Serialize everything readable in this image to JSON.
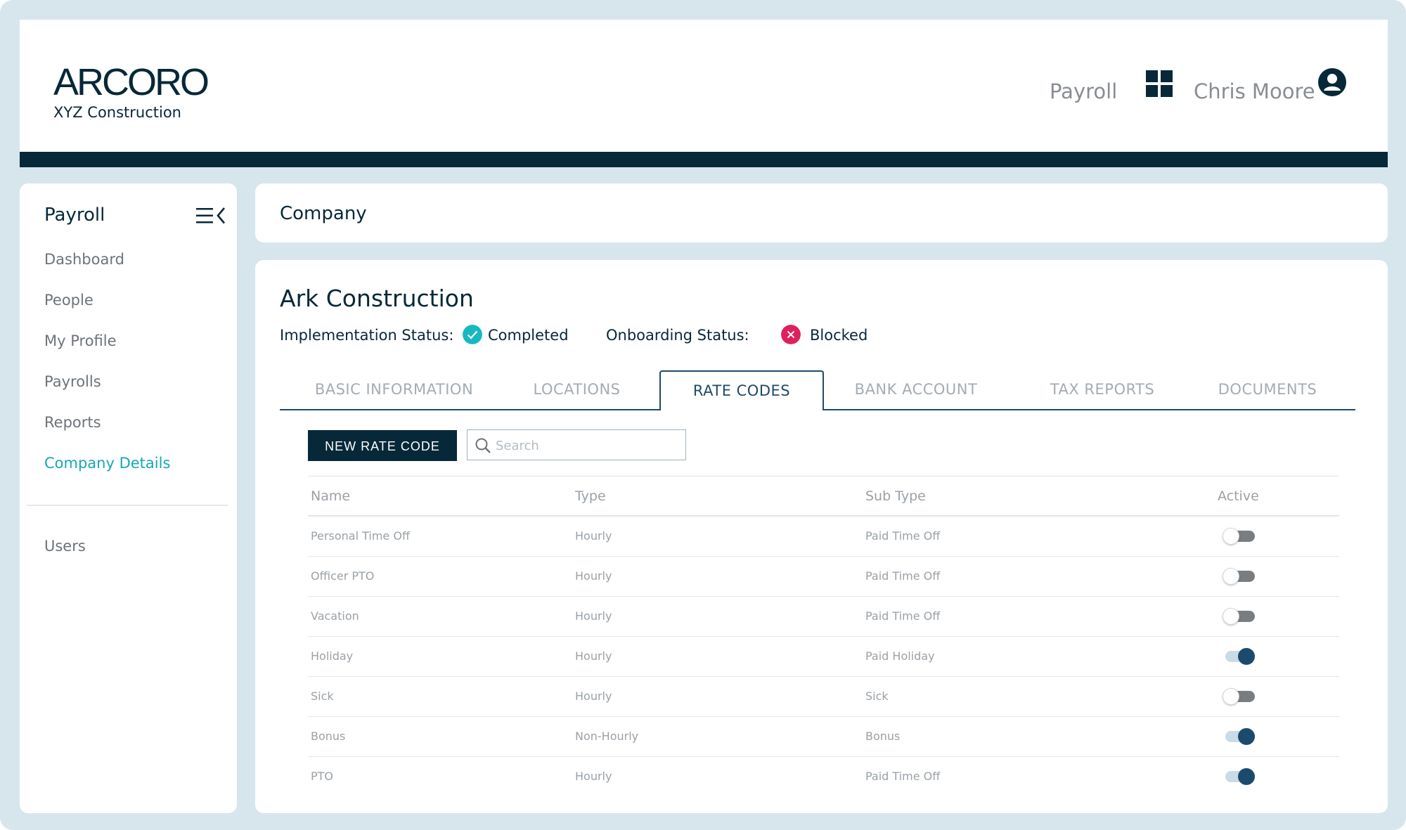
{
  "header": {
    "logo_text": "ARCORO",
    "company_subtitle": "XYZ Construction",
    "app_label": "Payroll",
    "app_switcher_icon": "grid-icon",
    "user_name": "Chris Moore",
    "user_icon": "user-circle-icon"
  },
  "sidebar": {
    "title": "Payroll",
    "toggle_icon": "menu-collapse-icon",
    "items": [
      {
        "label": "Dashboard",
        "active": false
      },
      {
        "label": "People",
        "active": false
      },
      {
        "label": "My Profile",
        "active": false
      },
      {
        "label": "Payrolls",
        "active": false
      },
      {
        "label": "Reports",
        "active": false
      },
      {
        "label": "Company Details",
        "active": true
      }
    ],
    "secondary_items": [
      {
        "label": "Users"
      }
    ]
  },
  "page": {
    "section_title": "Company",
    "company_name": "Ark Construction",
    "implementation_status_label": "Implementation Status:",
    "implementation_status_value": "Completed",
    "onboarding_status_label": "Onboarding Status:",
    "onboarding_status_value": "Blocked",
    "colors": {
      "completed": "#16b9c0",
      "blocked": "#e0205e",
      "accent": "#16a8b3",
      "primary_dark": "#062838"
    }
  },
  "tabs": [
    {
      "label": "BASIC INFORMATION",
      "active": false
    },
    {
      "label": "LOCATIONS",
      "active": false
    },
    {
      "label": "RATE CODES",
      "active": true
    },
    {
      "label": "BANK ACCOUNT",
      "active": false
    },
    {
      "label": "TAX REPORTS",
      "active": false
    },
    {
      "label": "DOCUMENTS",
      "active": false
    }
  ],
  "toolbar": {
    "new_button_label": "NEW RATE CODE",
    "search_placeholder": "Search"
  },
  "table": {
    "columns": [
      "Name",
      "Type",
      "Sub Type",
      "Active"
    ],
    "rows": [
      {
        "name": "Personal Time Off",
        "type": "Hourly",
        "sub_type": "Paid Time Off",
        "active": false
      },
      {
        "name": "Officer PTO",
        "type": "Hourly",
        "sub_type": "Paid Time Off",
        "active": false
      },
      {
        "name": "Vacation",
        "type": "Hourly",
        "sub_type": "Paid Time Off",
        "active": false
      },
      {
        "name": "Holiday",
        "type": "Hourly",
        "sub_type": "Paid Holiday",
        "active": true
      },
      {
        "name": "Sick",
        "type": "Hourly",
        "sub_type": "Sick",
        "active": false
      },
      {
        "name": "Bonus",
        "type": "Non-Hourly",
        "sub_type": "Bonus",
        "active": true
      },
      {
        "name": "PTO",
        "type": "Hourly",
        "sub_type": "Paid Time Off",
        "active": true
      }
    ]
  }
}
